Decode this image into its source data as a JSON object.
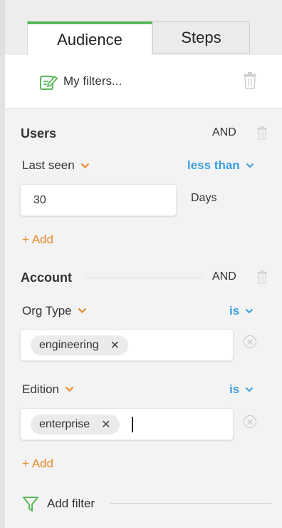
{
  "tabs": [
    {
      "label": "Audience",
      "active": true
    },
    {
      "label": "Steps",
      "active": false
    }
  ],
  "header": {
    "my_filters_label": "My filters..."
  },
  "users": {
    "title": "Users",
    "logic": "AND",
    "field": {
      "label": "Last seen",
      "operator": "less than",
      "value": "30",
      "unit": "Days"
    },
    "add_label": "+ Add"
  },
  "account": {
    "title": "Account",
    "logic": "AND",
    "fields": [
      {
        "label": "Org Type",
        "operator": "is",
        "chips": [
          "engineering"
        ]
      },
      {
        "label": "Edition",
        "operator": "is",
        "chips": [
          "enterprise"
        ]
      }
    ],
    "add_label": "+ Add"
  },
  "footer": {
    "add_filter_label": "Add filter"
  },
  "colors": {
    "accent_green": "#58b85c",
    "orange": "#e68a2e",
    "blue": "#3aa0dc"
  },
  "icons": [
    "edit-filter-icon",
    "trash-icon",
    "chevron-down-icon",
    "close-icon",
    "circle-x-icon",
    "funnel-icon"
  ]
}
